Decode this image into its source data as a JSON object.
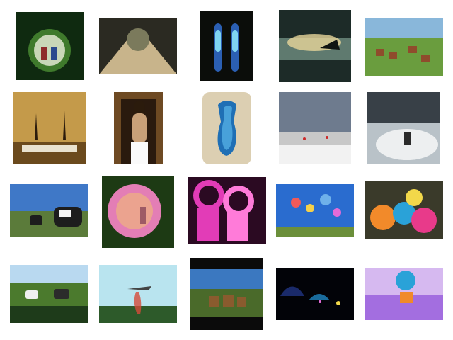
{
  "gallery": {
    "thumbnails": [
      {
        "subject": "mirror-ball-reflection",
        "colors": [
          "#0f2a10",
          "#3f7a2c",
          "#c9d7b8"
        ]
      },
      {
        "subject": "tree-tunnel-path",
        "colors": [
          "#2b2a22",
          "#7b7a5c",
          "#c8b48b"
        ]
      },
      {
        "subject": "toothbrush-heads",
        "colors": [
          "#0b0d0a",
          "#2b5fb3",
          "#7fd4f0"
        ]
      },
      {
        "subject": "tree-on-island-at-dusk",
        "colors": [
          "#1d2b28",
          "#5f7a6f",
          "#e7d69a"
        ]
      },
      {
        "subject": "deer-in-meadow",
        "colors": [
          "#89b7da",
          "#6a9d3e",
          "#8f4c2c"
        ]
      },
      {
        "subject": "sheep-under-trees",
        "colors": [
          "#6b4a1d",
          "#c49a4a",
          "#2b1b0c"
        ]
      },
      {
        "subject": "woman-in-doorway",
        "colors": [
          "#6e4a23",
          "#c8a078",
          "#fafafa"
        ]
      },
      {
        "subject": "blue-glass-vase",
        "colors": [
          "#dccfb2",
          "#1f6fb5",
          "#5ab7ea"
        ]
      },
      {
        "subject": "kites-on-beach",
        "colors": [
          "#6e7b8e",
          "#c8c8c8",
          "#f2f2f2"
        ]
      },
      {
        "subject": "horse-riders-in-mist",
        "colors": [
          "#384047",
          "#b9c2c8",
          "#f3f4f4"
        ]
      },
      {
        "subject": "cows-in-field",
        "colors": [
          "#3f78c7",
          "#5b7b3a",
          "#1d1d1d"
        ]
      },
      {
        "subject": "pink-umbrella",
        "colors": [
          "#1d3a14",
          "#e37eb5",
          "#f4c86a"
        ]
      },
      {
        "subject": "pink-scissor-handles",
        "colors": [
          "#2b0a22",
          "#e23cb7",
          "#ff7bd9"
        ]
      },
      {
        "subject": "animal-balloons-sky",
        "colors": [
          "#2a6ccf",
          "#6fb1ea",
          "#6b8f3a"
        ]
      },
      {
        "subject": "colorful-umbrellas",
        "colors": [
          "#3a3a2a",
          "#f28a2a",
          "#2aa2d8"
        ]
      },
      {
        "subject": "cattle-at-river",
        "colors": [
          "#b9d9f0",
          "#4b7a2d",
          "#1e3b1a"
        ]
      },
      {
        "subject": "firefighting-plane",
        "colors": [
          "#b9e4ef",
          "#2d5a2a",
          "#d64a3a"
        ]
      },
      {
        "subject": "horses-in-valley",
        "colors": [
          "#0b0b0b",
          "#3b78c0",
          "#8a5b2e"
        ]
      },
      {
        "subject": "night-tents",
        "colors": [
          "#020308",
          "#1a2a6a",
          "#2ab0ff"
        ]
      },
      {
        "subject": "chair-in-purple-field",
        "colors": [
          "#d6b9f0",
          "#a36ee0",
          "#f08a2a"
        ]
      }
    ]
  }
}
